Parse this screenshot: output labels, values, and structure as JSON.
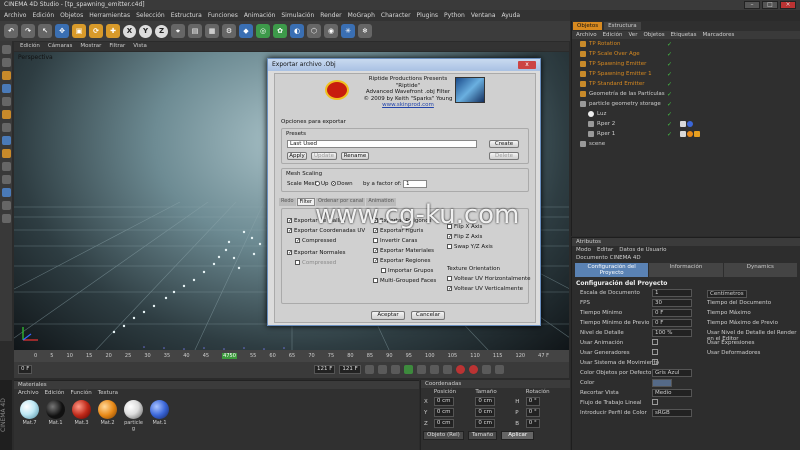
{
  "window": {
    "title": "CINEMA 4D Studio - [tp_spawning_emitter.c4d]"
  },
  "menu": [
    "Archivo",
    "Edición",
    "Objetos",
    "Herramientas",
    "Selección",
    "Estructura",
    "Funciones",
    "Animación",
    "Simulación",
    "Render",
    "MoGraph",
    "Character",
    "Plugins",
    "Python",
    "Ventana",
    "Ayuda"
  ],
  "toolbar": {
    "axes": [
      "X",
      "Y",
      "Z"
    ]
  },
  "viewport": {
    "menu": [
      "Edición",
      "Cámaras",
      "Mostrar",
      "Filtrar",
      "Vista"
    ],
    "label": "Perspectiva"
  },
  "timeline": {
    "ticks": [
      "0",
      "5",
      "10",
      "15",
      "20",
      "25",
      "30",
      "35",
      "40",
      "45",
      "50",
      "55",
      "60",
      "65",
      "70",
      "75",
      "80",
      "85",
      "90",
      "95",
      "100",
      "105",
      "110",
      "115",
      "120"
    ],
    "marker": "4750",
    "end_label": "47 F",
    "start_field": "0 F",
    "current_field": "121 F",
    "end_field": "121 F",
    "fps_field": "121 F"
  },
  "materials": {
    "header": "Materiales",
    "menu": [
      "Archivo",
      "Edición",
      "Función",
      "Textura"
    ],
    "items": [
      {
        "name": "Mat.7",
        "color": "#bfe9f5"
      },
      {
        "name": "Mat.1",
        "color": "#111111"
      },
      {
        "name": "Mat.3",
        "color": "#c02a1a"
      },
      {
        "name": "Mat.2",
        "color": "#e88a18"
      },
      {
        "name": "particle g",
        "color": "#dddddd"
      },
      {
        "name": "Mat.1",
        "color": "#3a66d8"
      }
    ]
  },
  "coords": {
    "header": "Coordenadas",
    "cols": [
      "Posición",
      "Tamaño",
      "Rotación"
    ],
    "rows": [
      {
        "axis": "X",
        "pos": "0 cm",
        "size": "0 cm",
        "rot_axis": "H",
        "rot": "0 °"
      },
      {
        "axis": "Y",
        "pos": "0 cm",
        "size": "0 cm",
        "rot_axis": "P",
        "rot": "0 °"
      },
      {
        "axis": "Z",
        "pos": "0 cm",
        "size": "0 cm",
        "rot_axis": "B",
        "rot": "0 °"
      }
    ],
    "mode1": "Objeto (Rel)",
    "mode2": "Tamaño",
    "apply": "Aplicar"
  },
  "objects": {
    "tabs": [
      "Objetos",
      "Estructura"
    ],
    "menu": [
      "Archivo",
      "Edición",
      "Ver",
      "Objetos",
      "Etiquetas",
      "Marcadores"
    ],
    "items": [
      {
        "name": "TP Rotation",
        "indent": 0,
        "kind": "part",
        "orange": true
      },
      {
        "name": "TP Scale Over Age",
        "indent": 0,
        "kind": "part",
        "orange": true
      },
      {
        "name": "TP Spawning Emitter",
        "indent": 0,
        "kind": "part",
        "orange": true
      },
      {
        "name": "TP Spawning Emitter 1",
        "indent": 0,
        "kind": "part",
        "orange": true
      },
      {
        "name": "TP Standard Emitter",
        "indent": 0,
        "kind": "part",
        "orange": true
      },
      {
        "name": "Geometría de las Partículas",
        "indent": 0,
        "kind": "part",
        "orange": false
      },
      {
        "name": "particle geometry storage",
        "indent": 0,
        "kind": "obj",
        "orange": false
      },
      {
        "name": "Luz",
        "indent": 1,
        "kind": "light",
        "orange": false
      },
      {
        "name": "Rper 2",
        "indent": 1,
        "kind": "obj",
        "orange": false
      },
      {
        "name": "Rper 1",
        "indent": 1,
        "kind": "obj",
        "orange": false
      },
      {
        "name": "scene",
        "indent": 0,
        "kind": "obj",
        "orange": false
      }
    ]
  },
  "attributes": {
    "header": "Atributos",
    "menu": [
      "Modo",
      "Editar",
      "Datos de Usuario"
    ],
    "doc": "Documento CINEMA 4D",
    "tabs": [
      "Configuración del Proyecto",
      "Información",
      "Dynamics"
    ],
    "section": "Configuración del Proyecto",
    "rows": [
      {
        "label": "Escala de Documento",
        "value": "1",
        "right": "Centímetros"
      },
      {
        "label": "FPS",
        "value": "30",
        "right": "Tiempo del Documento"
      },
      {
        "label": "Tiempo Mínimo",
        "value": "0 F",
        "right": "Tiempo Máximo"
      },
      {
        "label": "Tiempo Mínimo de Previo",
        "value": "0 F",
        "right": "Tiempo Máximo de Previo"
      },
      {
        "label": "Nivel de Detalle",
        "value": "100 %",
        "right": "Usar Nivel de Detalle del Render en el Editor"
      },
      {
        "label": "Usar Animación",
        "value": "",
        "right": "Usar Expresiones"
      },
      {
        "label": "Usar Generadores",
        "value": "",
        "right": "Usar Deformadores"
      },
      {
        "label": "Usar Sistema de Movimiento",
        "value": "",
        "right": ""
      },
      {
        "label": "Color Objetos por Defecto",
        "value": "Gris Azul",
        "right": ""
      },
      {
        "label": "Color",
        "value": "",
        "right": ""
      },
      {
        "label": "Recortar Vista",
        "value": "Medio",
        "right": ""
      },
      {
        "label": "Flujo de Trabajo Lineal",
        "value": "",
        "right": ""
      },
      {
        "label": "Introducir Perfil de Color",
        "value": "sRGB",
        "right": ""
      }
    ]
  },
  "dialog": {
    "title": "Exportar archivo .Obj",
    "close": "x",
    "header_lines": [
      "Riptide Productions Presents",
      "\"Riptide\"",
      "Advanced Wavefront .obj Filter",
      "© 2009 by Keith \"Sparks\" Young",
      "www.skinprod.com"
    ],
    "options_label": "Opciones para exportar",
    "presets_label": "Presets",
    "preset_value": "Last Used",
    "btn_create": "Create",
    "btn_apply": "Apply",
    "btn_update": "Update",
    "btn_rename": "Rename",
    "btn_delete": "Delete",
    "mesh_scaling_label": "Mesh Scaling",
    "scale_mesh": "Scale Mesh",
    "up": "Up",
    "down": "Down",
    "factor_label": "by a factor of:",
    "factor_value": "1",
    "tabs": [
      "Redo",
      "Filter",
      "Ordenar por canal",
      "Animation"
    ],
    "col1": [
      "Exportar de Mallas",
      "Exportar Coordenadas UV",
      "Compressed",
      "Exportar Normales",
      "Compressed"
    ],
    "col2": [
      "Exportar Polígonos",
      "Exportar Figuris",
      "Invertir Caras",
      "Exportar Materiales",
      "Exportar Regiones",
      "Importar Grupos",
      "Multi-Grouped Faces"
    ],
    "col3": [
      "Flip X Axis",
      "Flip Z Axis",
      "Swap Y/Z Axis"
    ],
    "texture_orientation": "Texture Orientation",
    "tex1": "Voltear UV Horizontalmente",
    "tex2": "Voltear UV Verticalmente",
    "accept": "Aceptar",
    "cancel": "Cancelar"
  },
  "brand": "CINEMA 4D",
  "watermark": "www.cg-ku.com"
}
